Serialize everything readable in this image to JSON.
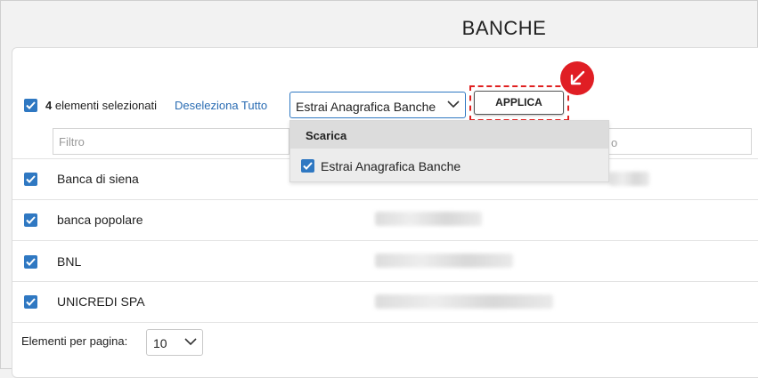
{
  "page": {
    "title": "BANCHE"
  },
  "toolbar": {
    "selected_count": "4",
    "selected_label": " elementi selezionati",
    "deselect_all": "Deseleziona Tutto",
    "action_select_value": "Estrai Anagrafica Banche",
    "apply_label": "APPLICA"
  },
  "filter": {
    "placeholder": "Filtro",
    "placeholder_short": "o"
  },
  "dropdown": {
    "group_label": "Scarica",
    "options": [
      {
        "label": "Estrai Anagrafica Banche",
        "checked": true
      }
    ]
  },
  "rows": [
    {
      "name": "Banca di siena",
      "checked": true
    },
    {
      "name": "banca popolare",
      "checked": true
    },
    {
      "name": "BNL",
      "checked": true
    },
    {
      "name": "UNICREDI SPA",
      "checked": true
    }
  ],
  "footer": {
    "per_page_label": "Elementi per pagina:",
    "per_page_value": "10"
  },
  "colors": {
    "accent": "#2f78c2",
    "highlight": "#e01e24"
  }
}
